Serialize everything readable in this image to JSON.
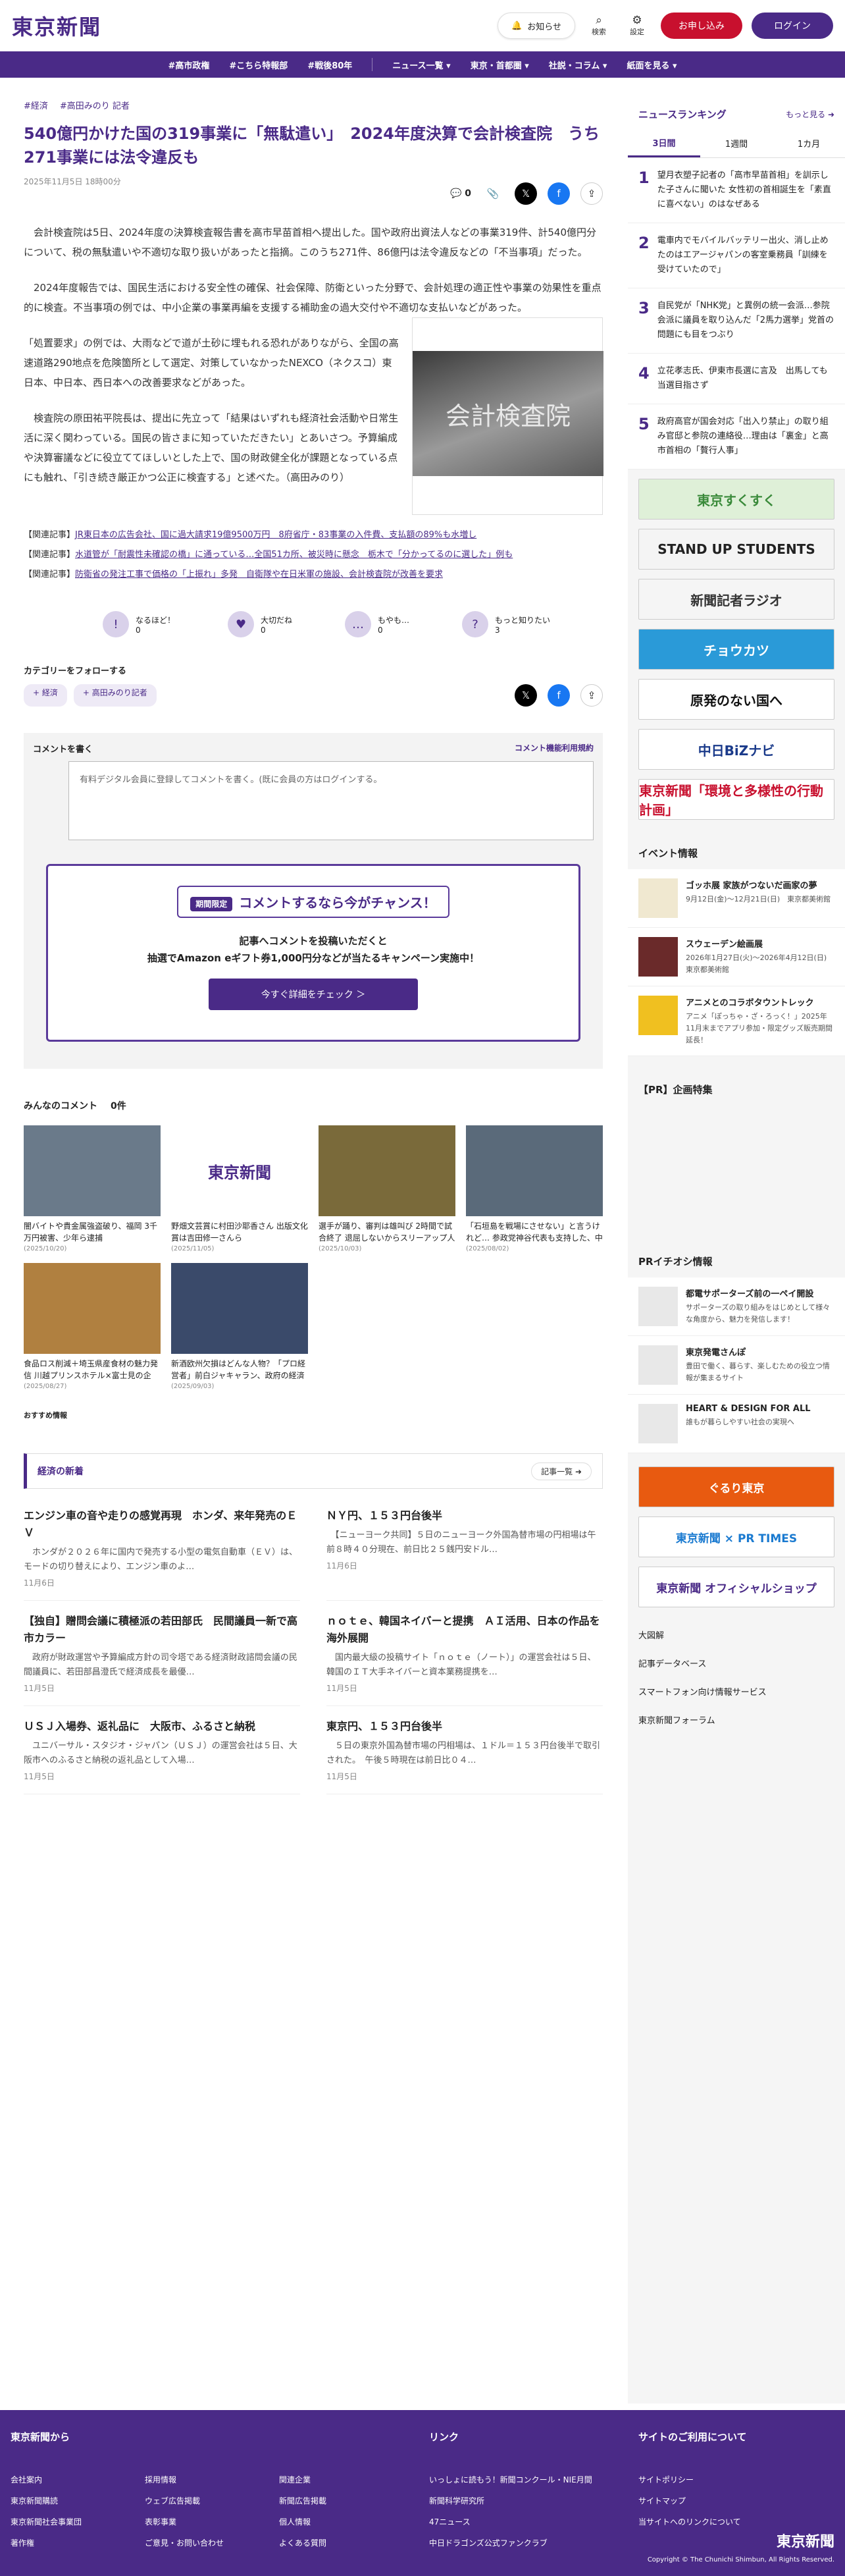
{
  "header": {
    "logo": "東京新聞",
    "notify": "お知らせ",
    "search": "検索",
    "settings": "設定",
    "subscribe": "お申し込み",
    "login": "ログイン"
  },
  "nav": [
    "#高市政権",
    "#こちら特報部",
    "#戦後80年",
    "ニュース一覧 ▾",
    "東京・首都圏 ▾",
    "社説・コラム ▾",
    "紙面を見る ▾"
  ],
  "article": {
    "tags": [
      "#経済",
      "#高田みのり 記者"
    ],
    "title": "540億円かけた国の319事業に「無駄遣い」　2024年度決算で会計検査院　うち271事業には法令違反も",
    "date": "2025年11月5日 18時00分",
    "comment_count": "0",
    "paragraphs": [
      "　会計検査院は5日、2024年度の決算検査報告書を高市早苗首相へ提出した。国や政府出資法人などの事業319件、計540億円分について、税の無駄遣いや不適切な取り扱いがあったと指摘。このうち271件、86億円は法令違反などの「不当事項」だった。",
      "　2024年度報告では、国民生活における安全性の確保、社会保障、防衛といった分野で、会計処理の適正性や事業の効果性を重点的に検査。不当事項の例では、中小企業の事業再編を支援する補助金の過大交付や不適切な支払いなどがあった。",
      "「処置要求」の例では、大雨などで道が土砂に埋もれる恐れがありながら、全国の高速道路290地点を危険箇所として選定、対策していなかったNEXCO（ネクスコ）東日本、中日本、西日本への改善要求などがあった。",
      "　検査院の原田祐平院長は、提出に先立って「結果はいずれも経済社会活動や日常生活に深く関わっている。国民の皆さまに知っていただきたい」とあいさつ。予算編成や決算審議などに役立ててほしいとした上で、国の財政健全化が課題となっている点にも触れ、「引き続き厳正かつ公正に検査する」と述べた。（高田みのり）"
    ],
    "photo_text": "会計検査院",
    "related": [
      {
        "label": "【関連記事】",
        "text": "JR東日本の広告会社、国に過大請求19億9500万円　8府省庁・83事業の入件費、支払額の89%も水増し"
      },
      {
        "label": "【関連記事】",
        "text": "水道管が「耐震性未確認の橋」に通っている…全国51カ所、被災時に懸念　栃木で「分かってるのに選した」例も"
      },
      {
        "label": "【関連記事】",
        "text": "防衛省の発注工事で価格の「上振れ」多発　自衛隊や在日米軍の施設、会計検査院が改善を要求"
      }
    ]
  },
  "reactions": [
    {
      "label": "なるほど！",
      "count": "0"
    },
    {
      "label": "大切だね",
      "count": "0"
    },
    {
      "label": "もやも…",
      "count": "0"
    },
    {
      "label": "もっと知りたい",
      "count": "3"
    }
  ],
  "category": {
    "title": "カテゴリーをフォローする",
    "chips": [
      "+ 経済",
      "+ 高田みのり記者"
    ]
  },
  "comment": {
    "title": "コメントを書く",
    "terms": "コメント機能利用規約",
    "placeholder": "有料デジタル会員に登録してコメントを書く。(既に会員の方はログインする。",
    "promo_badge": "期間限定",
    "promo_title": "コメントするなら今がチャンス！",
    "promo_text1": "記事へコメントを投稿いただくと",
    "promo_text2": "抽選でAmazon eギフト券1,000円分などが当たるキャンペーン実施中！",
    "promo_button": "今すぐ詳細をチェック ＞"
  },
  "everyone": {
    "title": "みんなのコメント",
    "count": "0件"
  },
  "cards": [
    {
      "cap": "闇バイトや貴金属強盗破り、福岡 3千万円被害、少年ら逮捕",
      "date": "(2025/10/20)",
      "c": "#6a7a8a"
    },
    {
      "cap": "野畑文芸賞に村田沙耶香さん 出版文化賞は吉田修一さんら",
      "date": "(2025/11/05)",
      "c": "#fff"
    },
    {
      "cap": "選手が踊り、審判は雄叫び 2時間で試合終了 退屈しないからスリーアップ人気？サバンナ…",
      "date": "(2025/10/03)",
      "c": "#7a6a3a"
    },
    {
      "cap": "「石垣島を戦場にさせない」と言うけれど… 参政党神谷代表も支持した、中山義隆市長の5…",
      "date": "(2025/08/02)",
      "c": "#5a6a7a"
    },
    {
      "cap": "食品ロス削減＋埼玉県産食材の魅力発信 川越プリンスホテル×富士見の企業、特別メニュー…",
      "date": "(2025/08/27)",
      "c": "#b08040"
    },
    {
      "cap": "新酒欧州欠損はどんな人物？「プロ経営者」前白ジャキャラン、政府の経済政策に関与、政権に予…",
      "date": "(2025/09/03)",
      "c": "#3a4a6a"
    }
  ],
  "recommend": "おすすめ情報",
  "economy": {
    "title": "経済の新着",
    "more": "記事一覧 ➜",
    "items": [
      {
        "h": "エンジン車の音や走りの感覚再現　ホンダ、来年発売のＥＶ",
        "p": "　ホンダが２０２６年に国内で発売する小型の電気自動車（ＥＶ）は、モードの切り替えにより、エンジン車のよ…",
        "d": "11月6日"
      },
      {
        "h": "ＮＹ円、１５３円台後半",
        "p": "　【ニューヨーク共同】５日のニューヨーク外国為替市場の円相場は午前８時４０分現在、前日比２５銭円安ドル…",
        "d": "11月6日"
      },
      {
        "h": "【独自】贈問会議に積極派の若田部氏　民間議員一新で高市カラー",
        "p": "　政府が財政運営や予算編成方針の司令塔である経済財政諮問会議の民間議員に、若田部昌澄氏で経済成長を最優…",
        "d": "11月5日"
      },
      {
        "h": "ｎｏｔｅ、韓国ネイバーと提携　ＡＩ活用、日本の作品を海外展開",
        "p": "　国内最大級の投稿サイト「ｎｏｔｅ（ノート）」の運営会社は５日、韓国のＩＴ大手ネイバーと資本業務提携を…",
        "d": "11月5日"
      },
      {
        "h": "ＵＳＪ入場券、返礼品に　大阪市、ふるさと納税",
        "p": "　ユニバーサル・スタジオ・ジャパン（ＵＳＪ）の運営会社は５日、大阪市へのふるさと納税の返礼品として入場…",
        "d": "11月5日"
      },
      {
        "h": "東京円、１５３円台後半",
        "p": "　５日の東京外国為替市場の円相場は、１ドル＝１５３円台後半で取引された。　午後５時現在は前日比０４…",
        "d": "11月5日"
      }
    ]
  },
  "ranking": {
    "title": "ニュースランキング",
    "more": "もっと見る ➜",
    "tabs": [
      "3日間",
      "1週間",
      "1カ月"
    ],
    "items": [
      "望月衣塑子記者の「高市早苗首相」を訓示した子さんに聞いた 女性初の首相誕生を「素直に喜べない」のはなぜある",
      "電車内でモバイルバッテリー出火、消し止めたのはエアージャパンの客室乗務員「訓練を受けていたので」",
      "自民党が「NHK党」と異例の統一会派…参院会派に議員を取り込んだ「2馬力選挙」党首の問題にも目をつぶり",
      "立花孝志氏、伊東市長選に言及　出馬しても当選目指さず",
      "政府高官が国会対応「出入り禁止」の取り組み官邸と参院の連絡役…理由は「裏金」と高市首相の「贅行人事」"
    ]
  },
  "banners": [
    {
      "t": "東京すくすく",
      "bg": "#dff0d8",
      "fg": "#3a8a3a"
    },
    {
      "t": "STAND UP STUDENTS",
      "bg": "#f4f4f4",
      "fg": "#222"
    },
    {
      "t": "新聞記者ラジオ",
      "bg": "#f5f5f5",
      "fg": "#333"
    },
    {
      "t": "チョウカツ",
      "bg": "#2a9ad8",
      "fg": "#fff"
    },
    {
      "t": "原発のない国へ",
      "bg": "#fff",
      "fg": "#111"
    },
    {
      "t": "中日BiZナビ",
      "bg": "#fff",
      "fg": "#1a3a8a"
    },
    {
      "t": "東京新聞「環境と多様性の行動計画」",
      "bg": "#fff",
      "fg": "#c8102e"
    }
  ],
  "events": {
    "title": "イベント情報",
    "items": [
      {
        "t": "ゴッホ展 家族がつないだ画家の夢",
        "x": "9月12日(金)〜12月21日(日)　東京都美術館",
        "c": "#f0e8d0"
      },
      {
        "t": "スウェーデン絵画展",
        "x": "2026年1月27日(火)〜2026年4月12日(日)　東京都美術館",
        "c": "#6a2a2a"
      },
      {
        "t": "アニメとのコラボタウントレック",
        "x": "アニメ「ぽっちゃ・ざ・ろっく！」2025年11月末までアプリ参加・限定グッズ販売期間延長！",
        "c": "#f0c020"
      }
    ]
  },
  "pr": "【PR】企画特集",
  "pr_event": {
    "title": "PRイチオシ情報",
    "items": [
      {
        "t": "都電サポーターズ前の一ペイ開設",
        "x": "サポーターズの取り組みをはじめとして様々な角度から、魅力を発信します！"
      },
      {
        "t": "東京発電さんぽ",
        "x": "豊田で働く、暮らす、楽しむための役立つ情報が集まるサイト"
      },
      {
        "t": "HEART & DESIGN FOR ALL",
        "x": "誰もが暮らしやすい社会の実現へ"
      }
    ]
  },
  "ads": [
    {
      "t": "ぐるり東京",
      "bg": "#e85a10",
      "fg": "#fff"
    },
    {
      "t": "東京新聞 × PR TIMES",
      "bg": "#fff",
      "fg": "#1a7ad0"
    },
    {
      "t": "東京新聞 オフィシャルショップ",
      "bg": "#fff",
      "fg": "#4a2a87"
    }
  ],
  "side_links": [
    "大図解",
    "記事データベース",
    "スマートフォン向け情報サービス",
    "東京新聞フォーラム"
  ],
  "footer": {
    "c1": "東京新聞から",
    "c2": "リンク",
    "c3": "サイトのご利用について",
    "col1": [
      "会社案内",
      "東京新聞購読",
      "東京新聞社会事業団",
      "著作権"
    ],
    "col2": [
      "採用情報",
      "ウェブ広告掲載",
      "表彰事業",
      "ご意見・お問い合わせ"
    ],
    "col3": [
      "関連企業",
      "新聞広告掲載",
      "個人情報",
      "よくある質問"
    ],
    "col4": [
      "いっしょに読もう！新聞コンクール・NIE月間",
      "新聞科学研究所",
      "47ニュース",
      "中日ドラゴンズ公式ファンクラブ"
    ],
    "col5": [
      "サイトポリシー",
      "サイトマップ",
      "当サイトへのリンクについて"
    ],
    "copy": "Copyright © The Chunichi Shimbun, All Rights Reserved."
  }
}
